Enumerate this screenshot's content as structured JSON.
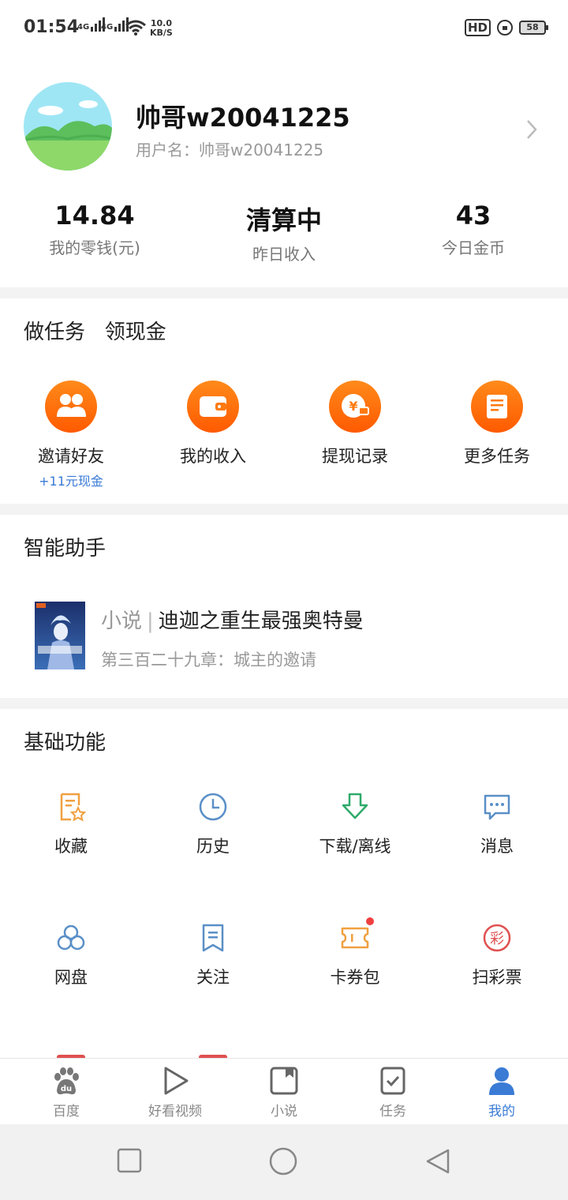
{
  "status_bar": {
    "time": "01:54",
    "net1": "4G",
    "net2": "4G",
    "speed_value": "10.0",
    "speed_unit": "KB/S",
    "hd": "HD",
    "battery": "58"
  },
  "profile": {
    "nickname": "帅哥w20041225",
    "username_label": "用户名：帅哥w20041225",
    "stats": [
      {
        "value": "14.84",
        "label": "我的零钱(元)"
      },
      {
        "value": "清算中",
        "label": "昨日收入"
      },
      {
        "value": "43",
        "label": "今日金币"
      }
    ]
  },
  "tasks": {
    "title": "做任务   领现金",
    "items": [
      {
        "label": "邀请好友",
        "sub": "+11元现金",
        "icon": "friends-icon"
      },
      {
        "label": "我的收入",
        "icon": "wallet-icon"
      },
      {
        "label": "提现记录",
        "icon": "withdraw-record-icon"
      },
      {
        "label": "更多任务",
        "icon": "more-tasks-icon"
      }
    ]
  },
  "assistant": {
    "title": "智能助手",
    "category": "小说",
    "separator": "|",
    "novel_title": "迪迦之重生最强奥特曼",
    "chapter": "第三百二十九章：城主的邀请"
  },
  "basic": {
    "title": "基础功能",
    "items": [
      {
        "label": "收藏",
        "icon": "favorite-icon"
      },
      {
        "label": "历史",
        "icon": "history-icon"
      },
      {
        "label": "下载/离线",
        "icon": "download-icon"
      },
      {
        "label": "消息",
        "icon": "message-icon"
      },
      {
        "label": "网盘",
        "icon": "netdisk-icon"
      },
      {
        "label": "关注",
        "icon": "follow-icon"
      },
      {
        "label": "卡券包",
        "icon": "coupon-icon"
      },
      {
        "label": "扫彩票",
        "icon": "lottery-icon"
      }
    ]
  },
  "tabbar": {
    "items": [
      {
        "label": "百度",
        "icon": "baidu-paw-icon"
      },
      {
        "label": "好看视频",
        "icon": "play-icon"
      },
      {
        "label": "小说",
        "icon": "novel-icon"
      },
      {
        "label": "任务",
        "icon": "task-check-icon"
      },
      {
        "label": "我的",
        "icon": "person-icon",
        "active": true
      }
    ]
  },
  "colors": {
    "accent_orange": "#ff6a00",
    "active_blue": "#3a7bd5",
    "icon_blue": "#5a8fc7",
    "icon_orange": "#f0a040",
    "icon_green": "#2faa6a",
    "red": "#e05050"
  }
}
